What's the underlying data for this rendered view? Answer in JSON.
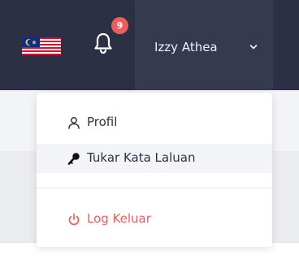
{
  "header": {
    "language_flag_icon": "flag-malaysia-icon",
    "notification_icon": "bell-icon",
    "notification_count": "9",
    "user_name": "Izzy Athea",
    "user_menu_icon": "chevron-down-icon"
  },
  "user_menu": {
    "items": [
      {
        "label": "Profil",
        "icon": "user-icon"
      },
      {
        "label": "Tukar Kata Laluan",
        "icon": "key-icon"
      },
      {
        "label": "Log Keluar",
        "icon": "power-icon"
      }
    ]
  },
  "colors": {
    "topbar": "#2b3044",
    "user_area": "#353a4f",
    "badge": "#f05c5c",
    "danger": "#f05c5c",
    "hover": "#f3f4f8"
  }
}
